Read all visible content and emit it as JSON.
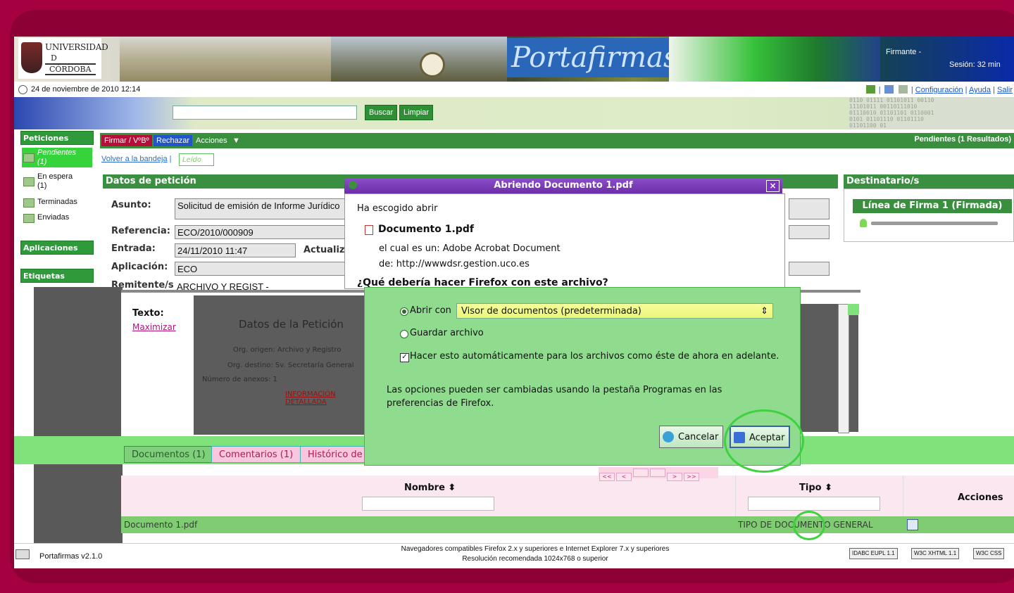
{
  "header": {
    "logo_line1": "UNIVERSIDAD",
    "logo_line2": "D",
    "logo_line3": "CÓRDOBA",
    "title": "Portafirmas",
    "firmante": "Firmante -",
    "sesion": "Sesión: 32 min"
  },
  "datebar": {
    "date": "24 de noviembre de 2010 12:14",
    "links": [
      "Configuración",
      "Ayuda",
      "Salir"
    ]
  },
  "search": {
    "buscar": "Buscar",
    "limpiar": "Limpiar"
  },
  "sidebar": {
    "peticiones": "Peticiones",
    "items": [
      {
        "label": "Pendientes",
        "count": "(1)"
      },
      {
        "label": "En espera",
        "count": "(1)"
      },
      {
        "label": "Terminadas",
        "count": ""
      },
      {
        "label": "Enviadas",
        "count": ""
      }
    ],
    "aplicaciones": "Aplicaciones",
    "etiquetas": "Etiquetas"
  },
  "toolbar": {
    "firmar": "Firmar / VºBº",
    "rechazar": "Rechazar",
    "acciones": "Acciones",
    "pendientes": "Pendientes (1 Resultados)"
  },
  "subtool": {
    "volver": "Volver a la bandeja",
    "leido": "Leído"
  },
  "datos": {
    "title": "Datos de petición",
    "asunto_label": "Asunto:",
    "asunto": "Solicitud de emisión de Informe Jurídico",
    "referencia_label": "Referencia:",
    "referencia": "ECO/2010/000909",
    "entrada_label": "Entrada:",
    "entrada": "24/11/2010 11:47",
    "actualiza_label": "Actualiz",
    "aplicacion_label": "Aplicación:",
    "aplicacion": "ECO",
    "remitente_label": "Remitente/s:",
    "remitente": "ARCHIVO Y REGIST -"
  },
  "destinatarios": {
    "title": "Destinatario/s",
    "linea": "Línea de Firma 1 (Firmada)"
  },
  "preview": {
    "texto_label": "Texto:",
    "maximizar": "Maximizar",
    "title": "Datos de la Petición",
    "line1": "Org. origen: Archivo y Registro",
    "line2": "Org. destino: Sv. Secretaría General",
    "line3": "Número de anexos: 1",
    "link": "INFORMACIÓN DETALLADA"
  },
  "tabs": [
    "Documentos (1)",
    "Comentarios (1)",
    "Histórico de"
  ],
  "table": {
    "col_nombre": "Nombre",
    "col_tipo": "Tipo",
    "col_acciones": "Acciones",
    "row_nombre": "Documento 1.pdf",
    "row_tipo": "TIPO DE DOCUMENTO GENERAL"
  },
  "pager": [
    "<<",
    "<",
    "",
    "",
    ">",
    ">>"
  ],
  "footer": {
    "version": "Portafirmas v2.1.0",
    "line1": "Navegadores compatibles Firefox 2.x y superiores e Internet Explorer 7.x y superiores",
    "line2": "Resolución recomendada 1024x768 o superior",
    "badges": [
      "IDABC EUPL 1.1",
      "W3C XHTML 1.1",
      "W3C CSS"
    ]
  },
  "dialog": {
    "title": "Abriendo Documento 1.pdf",
    "intro": "Ha escogido abrir",
    "filename": "Documento 1.pdf",
    "type_line": "el cual es un: Adobe Acrobat Document",
    "from_line": "de: http://wwwdsr.gestion.uco.es",
    "question": "¿Qué debería hacer Firefox con este archivo?",
    "abrir_con": "Abrir con",
    "app": "Visor de documentos (predeterminada)",
    "guardar": "Guardar archivo",
    "auto": "Hacer esto automáticamente para los archivos como éste de ahora en adelante.",
    "note": "Las opciones pueden ser cambiadas usando la pestaña Programas en las preferencias de Firefox.",
    "cancel": "Cancelar",
    "accept": "Aceptar"
  },
  "colors": {
    "frame": "#a5003f",
    "green": "#3a8f3f",
    "dialog_title": "#7b33c0",
    "highlight": "#3fd13f"
  }
}
